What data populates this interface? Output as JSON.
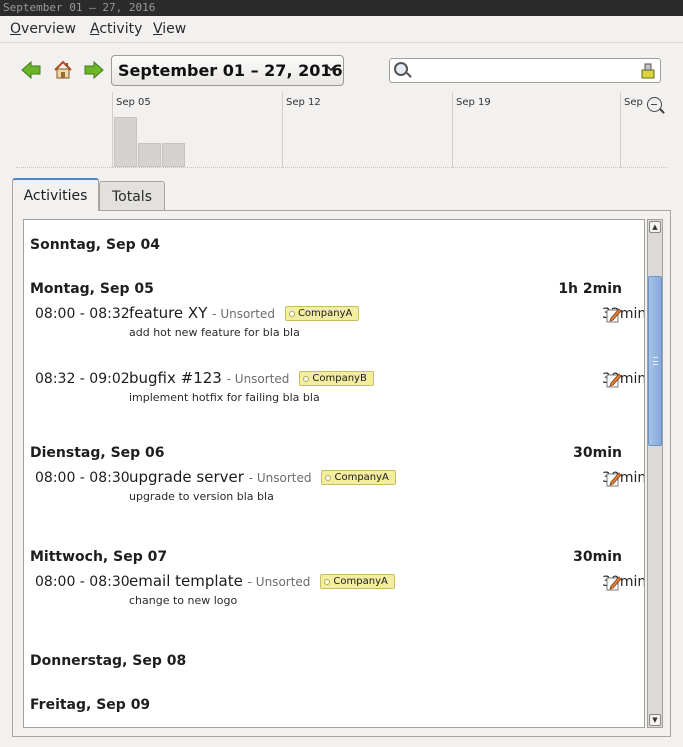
{
  "window": {
    "title": "September 01 – 27, 2016"
  },
  "menu": [
    {
      "label": "Overview",
      "mnemonic": "O",
      "rest": "verview"
    },
    {
      "label": "Activity",
      "mnemonic": "A",
      "rest": "ctivity"
    },
    {
      "label": "View",
      "mnemonic": "V",
      "rest": "iew"
    }
  ],
  "toolbar": {
    "date_range": "September 01 – 27, 2016",
    "search": {
      "value": "",
      "placeholder": ""
    },
    "icons": {
      "prev": "back-arrow-icon",
      "home": "home-icon",
      "next": "forward-arrow-icon",
      "search": "search-icon",
      "clear": "clear-icon"
    }
  },
  "timeline": {
    "ticks": [
      "Sep 05",
      "Sep 12",
      "Sep 19",
      "Sep"
    ],
    "daily_activity": [
      {
        "day": "Sep 05",
        "level": 0.7
      },
      {
        "day": "Sep 06",
        "level": 0.34
      },
      {
        "day": "Sep 07",
        "level": 0.34
      }
    ]
  },
  "tabs": [
    {
      "label": "Activities",
      "active": true
    },
    {
      "label": "Totals",
      "active": false
    }
  ],
  "days": [
    {
      "label": "Sonntag, Sep 04",
      "total": "",
      "facts": []
    },
    {
      "label": "Montag, Sep 05",
      "total": "1h 2min",
      "facts": [
        {
          "time": "08:00 - 08:32",
          "name": "feature XY",
          "category": "Unsorted",
          "tag": "CompanyA",
          "description": "add hot new feature for bla bla",
          "duration": "32min"
        },
        {
          "time": "08:32 - 09:02",
          "name": "bugfix #123",
          "category": "Unsorted",
          "tag": "CompanyB",
          "description": "implement hotfix for failing bla bla",
          "duration": "30min"
        }
      ]
    },
    {
      "label": "Dienstag, Sep 06",
      "total": "30min",
      "facts": [
        {
          "time": "08:00 - 08:30",
          "name": "upgrade server",
          "category": "Unsorted",
          "tag": "CompanyA",
          "description": "upgrade to version bla bla",
          "duration": "30min"
        }
      ]
    },
    {
      "label": "Mittwoch, Sep 07",
      "total": "30min",
      "facts": [
        {
          "time": "08:00 - 08:30",
          "name": "email template",
          "category": "Unsorted",
          "tag": "CompanyA",
          "description": "change to new logo",
          "duration": "30min"
        }
      ]
    },
    {
      "label": "Donnerstag, Sep 08",
      "total": "",
      "facts": []
    },
    {
      "label": "Freitag, Sep 09",
      "total": "",
      "facts": []
    }
  ],
  "colors": {
    "accent": "#4a86c6",
    "tag_bg": "#f2eda0",
    "arrow": "#5aa51c",
    "scroll_thumb": "#86aadc"
  }
}
